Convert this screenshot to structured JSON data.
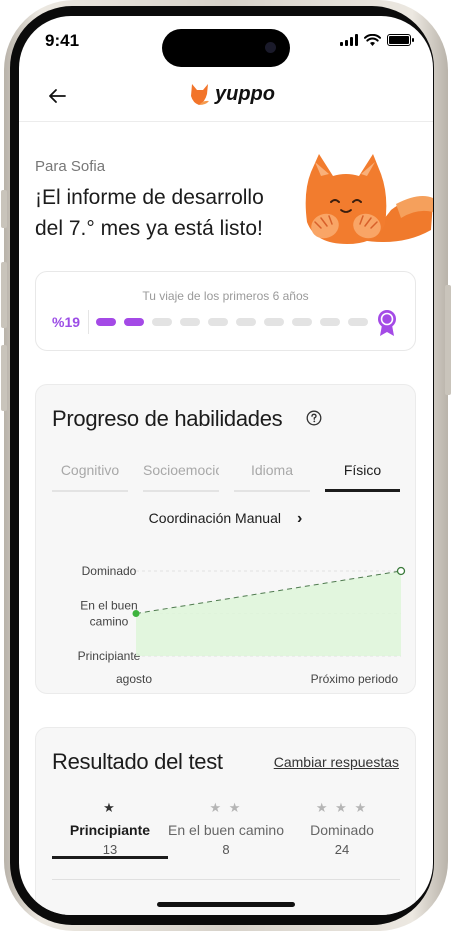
{
  "status_bar": {
    "time": "9:41"
  },
  "header": {
    "logo_text": "yuppo"
  },
  "greeting": {
    "subtitle": "Para Sofia",
    "title": "¡El informe de desarrollo del 7.° mes ya está listo!"
  },
  "journey": {
    "label": "Tu viaje de los primeros 6 años",
    "percent": "%19",
    "total_segments": 10,
    "filled_segments": 2,
    "accent_color": "#a44ae6"
  },
  "skills": {
    "title": "Progreso de habilidades",
    "tabs": [
      {
        "label": "Cognitivo",
        "active": false
      },
      {
        "label": "Socioemocional",
        "active": false
      },
      {
        "label": "Idioma",
        "active": false
      },
      {
        "label": "Físico",
        "active": true
      }
    ],
    "selected_skill": "Coordinación Manual"
  },
  "chart_data": {
    "type": "line",
    "title": "",
    "xlabel": "",
    "ylabel": "",
    "categories": [
      "agosto",
      "Próximo periodo"
    ],
    "y_levels": [
      "Principiante",
      "En el buen camino",
      "Dominado"
    ],
    "series": [
      {
        "values": [
          1,
          2
        ],
        "color": "#3db33d",
        "style": [
          "solid-point",
          "hollow-point"
        ]
      }
    ],
    "ylim": [
      0,
      2
    ],
    "grid": true,
    "fill_color": "#dff5da"
  },
  "test": {
    "title": "Resultado del test",
    "change_label": "Cambiar respuestas",
    "levels": [
      {
        "stars": "★",
        "name": "Principiante",
        "count": "13",
        "selected": true
      },
      {
        "stars": "★ ★",
        "name": "En el buen camino",
        "count": "8",
        "selected": false
      },
      {
        "stars": "★ ★ ★",
        "name": "Dominado",
        "count": "24",
        "selected": false
      }
    ]
  }
}
